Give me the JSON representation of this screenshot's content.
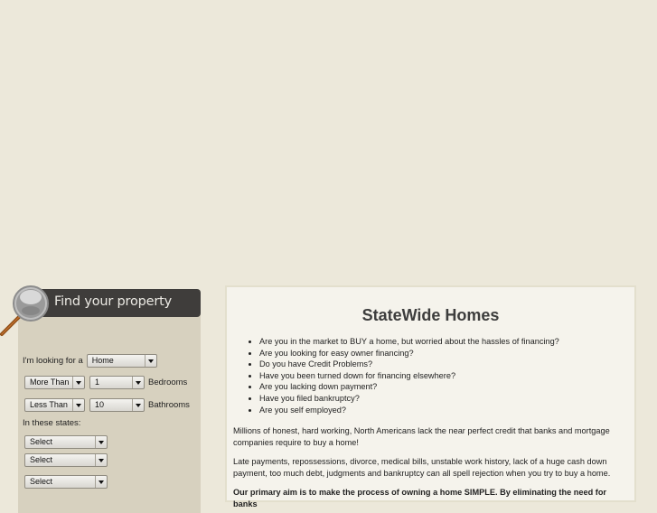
{
  "search_panel": {
    "title": "Find your property",
    "looking_for_label": "I'm looking for a",
    "property_type": "Home",
    "bedrooms_comparator": "More Than",
    "bedrooms_value": "1",
    "bedrooms_label": "Bedrooms",
    "bathrooms_comparator": "Less Than",
    "bathrooms_value": "10",
    "bathrooms_label": "Bathrooms",
    "states_label": "In these states:",
    "states": [
      "Select",
      "Select",
      "Select"
    ]
  },
  "content": {
    "title": "StateWide Homes",
    "bullets": [
      "Are you in the market to BUY a home, but worried about the hassles of financing?",
      "Are you looking for easy owner financing?",
      "Do you have Credit Problems?",
      "Have you been turned down for financing elsewhere?",
      "Are you lacking down payment?",
      "Have you filed bankruptcy?",
      "Are you self employed?"
    ],
    "para1": "Millions of honest, hard working, North Americans lack the near perfect credit that banks and mortgage companies require to buy a home!",
    "para2": "Late payments, repossessions, divorce, medical bills, unstable work history, lack of a huge cash down payment, too much debt, judgments and bankruptcy can all spell rejection when you try to buy a home.",
    "para3": "Our primary aim is to make the process of owning a home SIMPLE. By eliminating the need for banks"
  }
}
